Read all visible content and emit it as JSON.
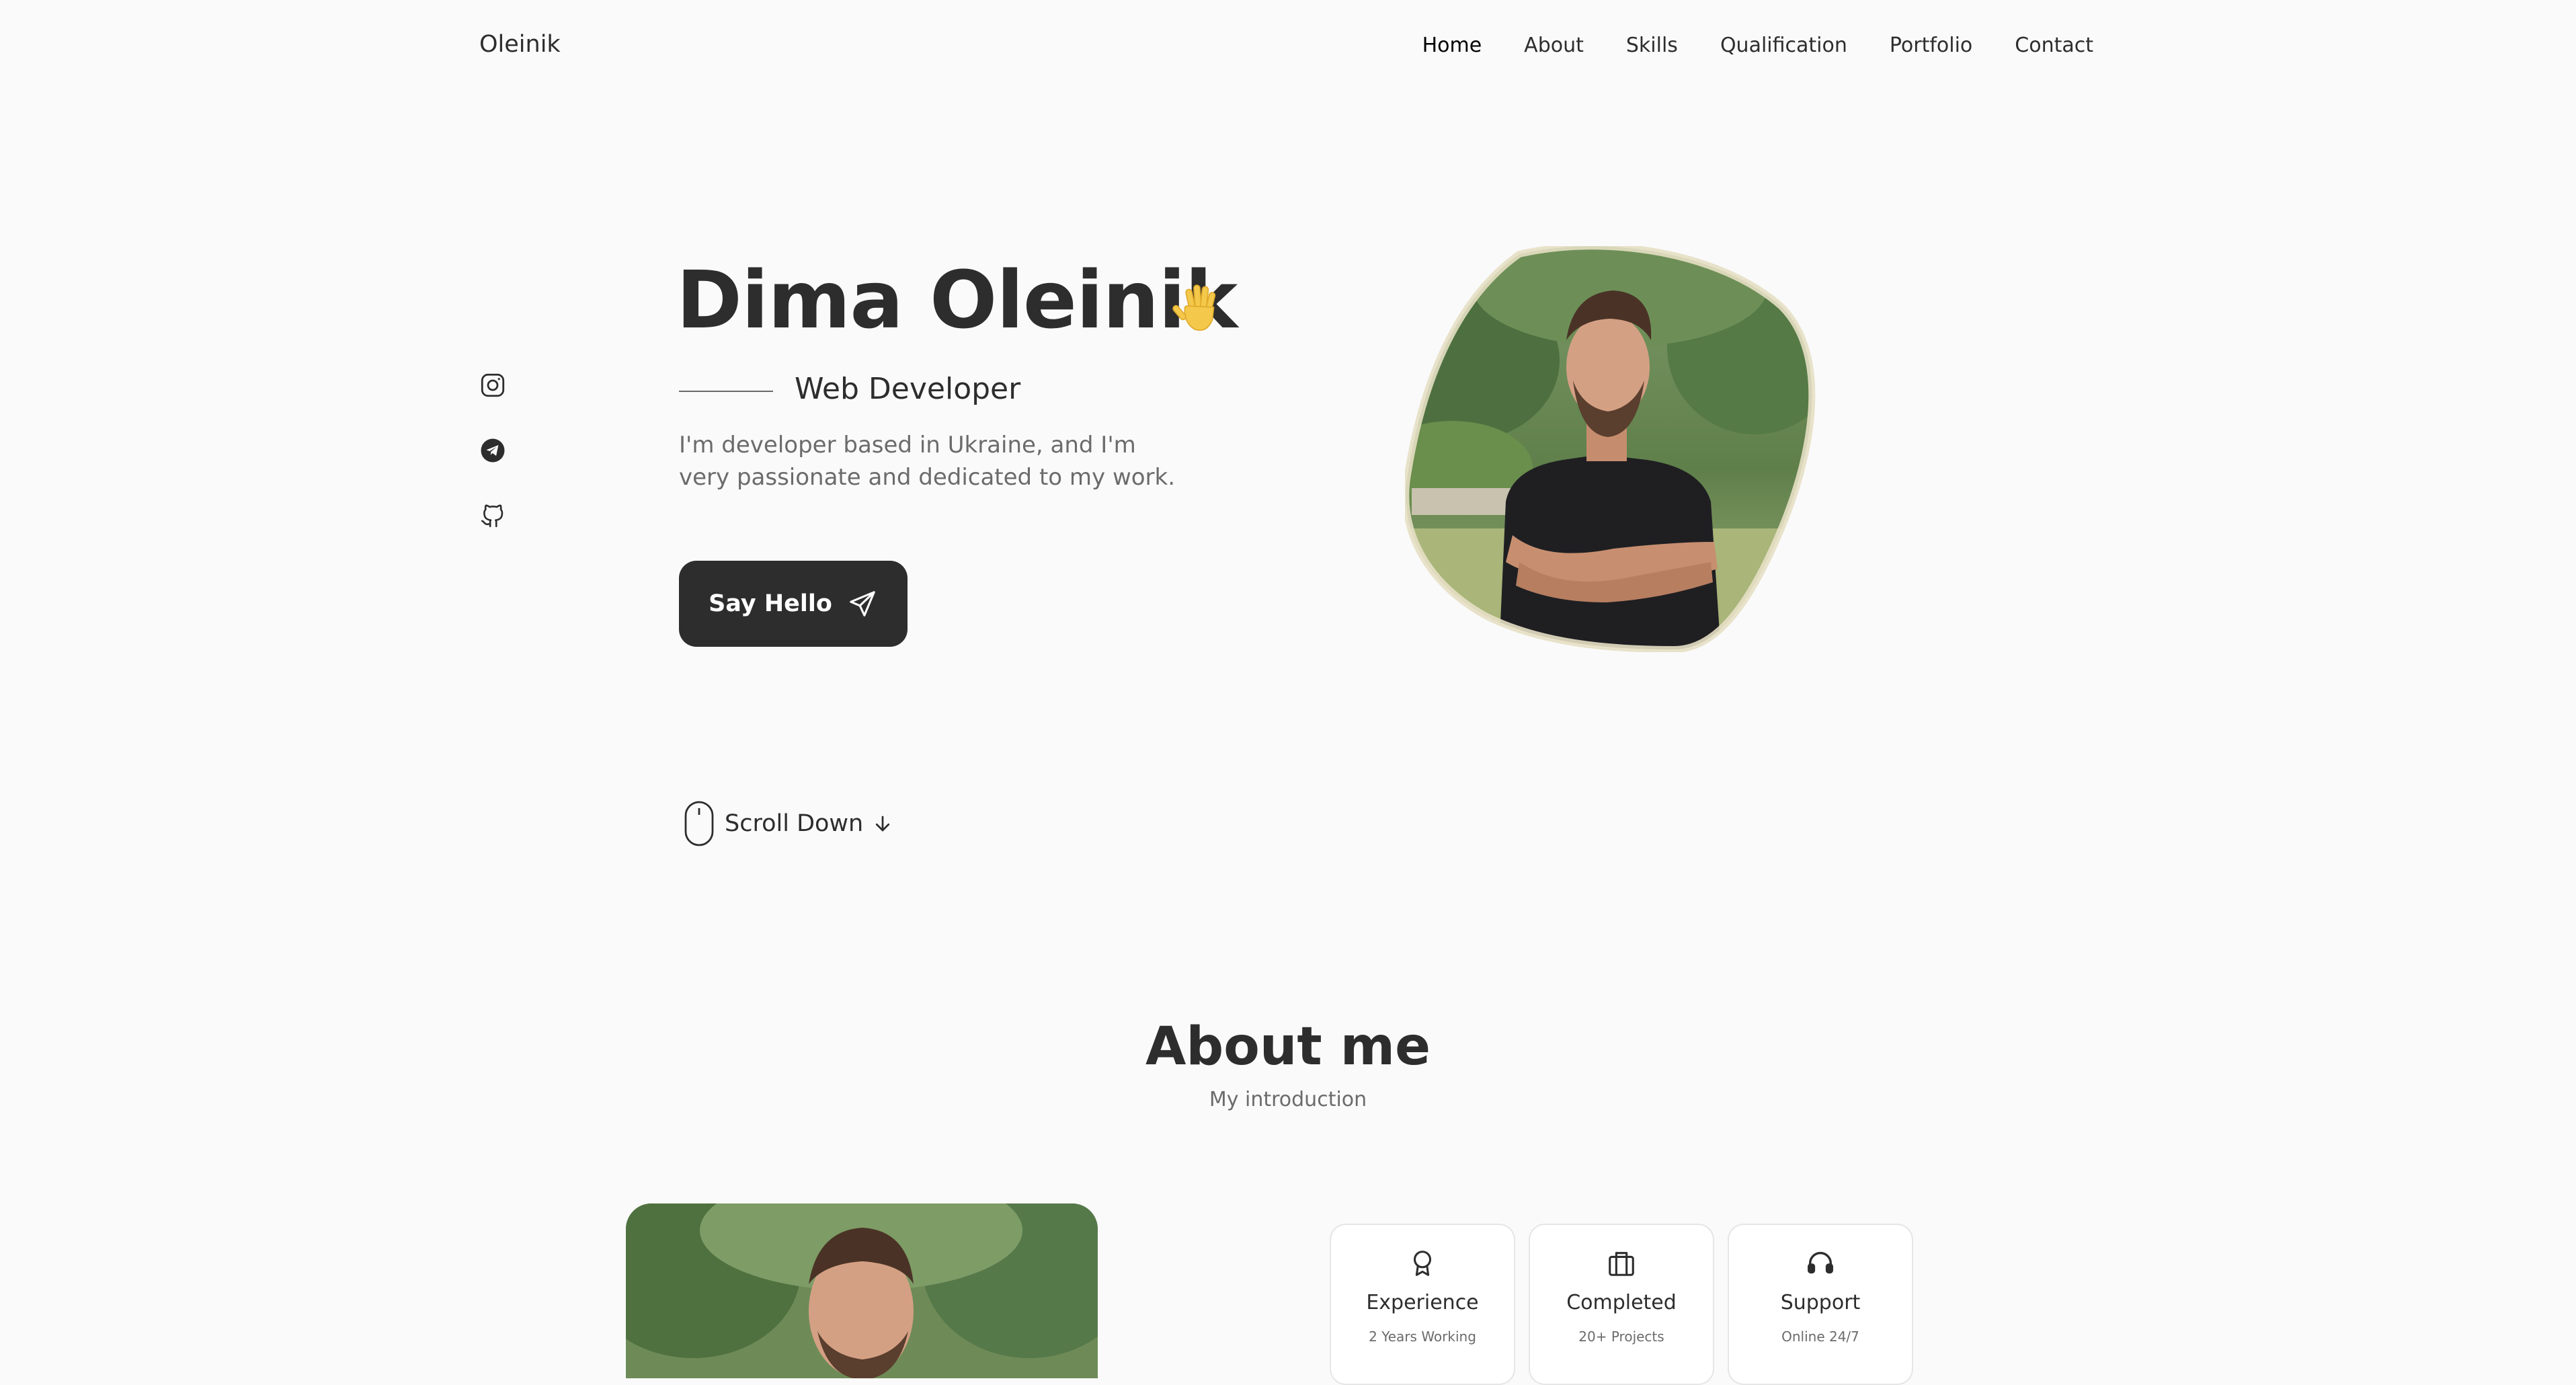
{
  "header": {
    "logo": "Oleinik",
    "nav": [
      {
        "label": "Home",
        "active": true
      },
      {
        "label": "About",
        "active": false
      },
      {
        "label": "Skills",
        "active": false
      },
      {
        "label": "Qualification",
        "active": false
      },
      {
        "label": "Portfolio",
        "active": false
      },
      {
        "label": "Contact",
        "active": false
      }
    ]
  },
  "social": [
    {
      "icon": "instagram-icon"
    },
    {
      "icon": "telegram-icon"
    },
    {
      "icon": "github-icon"
    }
  ],
  "hero": {
    "name": "Dima Oleinik",
    "wave_icon": "waving-hand-icon",
    "title": "Web Developer",
    "description": "I'm developer based in Ukraine, and I'm very passionate and dedicated to my work.",
    "button_label": "Say Hello",
    "button_icon": "send-icon"
  },
  "scroll": {
    "label": "Scroll Down",
    "mouse_icon": "mouse-icon",
    "arrow_icon": "arrow-down-icon"
  },
  "about": {
    "title": "About me",
    "subtitle": "My introduction",
    "cards": [
      {
        "icon": "award-icon",
        "title": "Experience",
        "subtitle": "2 Years Working"
      },
      {
        "icon": "briefcase-icon",
        "title": "Completed",
        "subtitle": "20+ Projects"
      },
      {
        "icon": "headset-icon",
        "title": "Support",
        "subtitle": "Online 24/7"
      }
    ]
  },
  "colors": {
    "background": "#fafafa",
    "text": "#2d2d2d",
    "muted": "#6b6b6b",
    "button": "#2d2d2d"
  }
}
